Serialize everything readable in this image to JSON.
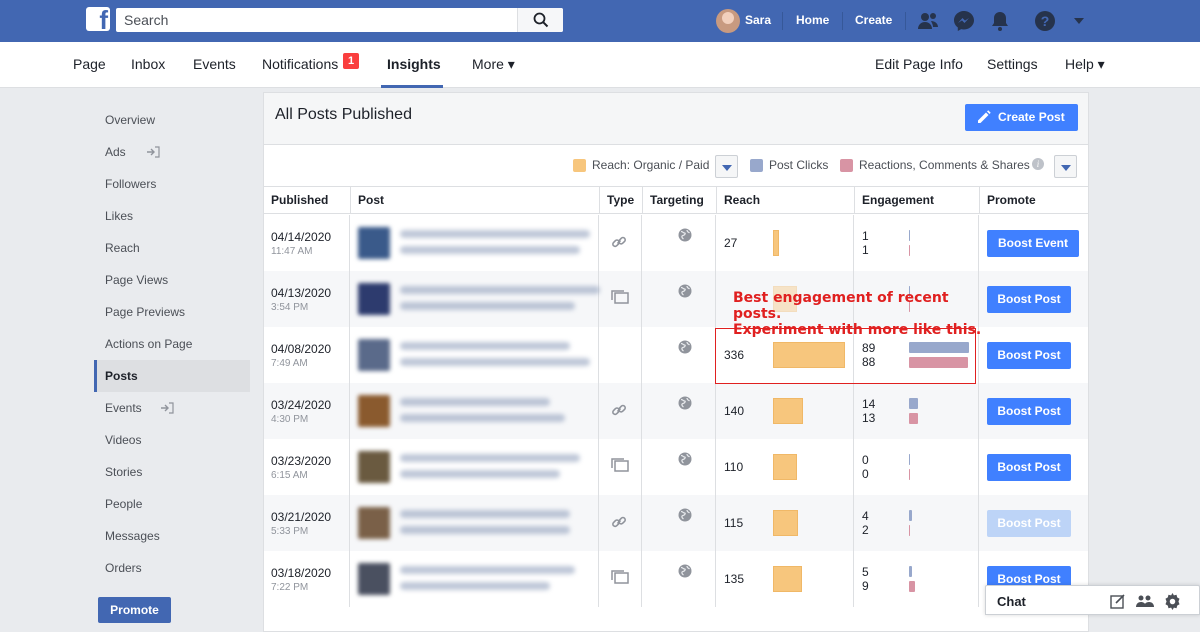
{
  "topbar": {
    "search_placeholder": "Search",
    "user_name": "Sara",
    "home": "Home",
    "create": "Create"
  },
  "tabs": [
    {
      "label": "Page"
    },
    {
      "label": "Inbox"
    },
    {
      "label": "Events"
    },
    {
      "label": "Notifications",
      "badge": "1"
    },
    {
      "label": "Insights",
      "active": true
    },
    {
      "label": "More ▾"
    },
    {
      "label": "Edit Page Info"
    },
    {
      "label": "Settings"
    },
    {
      "label": "Help ▾"
    }
  ],
  "sidebar": {
    "items": [
      {
        "label": "Overview"
      },
      {
        "label": "Ads"
      },
      {
        "label": "Followers"
      },
      {
        "label": "Likes"
      },
      {
        "label": "Reach"
      },
      {
        "label": "Page Views"
      },
      {
        "label": "Page Previews"
      },
      {
        "label": "Actions on Page"
      },
      {
        "label": "Posts",
        "active": true
      },
      {
        "label": "Events"
      },
      {
        "label": "Videos"
      },
      {
        "label": "Stories"
      },
      {
        "label": "People"
      },
      {
        "label": "Messages"
      },
      {
        "label": "Orders"
      }
    ],
    "promote": "Promote"
  },
  "panel": {
    "title": "All Posts Published",
    "create_post": "Create Post",
    "legend": {
      "reach": "Reach: Organic / Paid",
      "clicks": "Post Clicks",
      "reactions": "Reactions, Comments & Shares"
    },
    "colors": {
      "reach": "#f7c67d",
      "clicks": "#98a8cc",
      "reactions": "#d894a4",
      "boost": "#4080ff"
    },
    "headers": [
      "Published",
      "Post",
      "Type",
      "Targeting",
      "Reach",
      "Engagement",
      "Promote"
    ]
  },
  "rows": [
    {
      "date": "04/14/2020",
      "time": "11:47 AM",
      "type": "link-icon",
      "reach": "27",
      "clicks": "1",
      "reactions": "1",
      "promote": "Boost Event",
      "disabled": false
    },
    {
      "date": "04/13/2020",
      "time": "3:54 PM",
      "type": "album-icon",
      "reach": "",
      "clicks": "",
      "reactions": "",
      "promote": "Boost Post",
      "disabled": false
    },
    {
      "date": "04/08/2020",
      "time": "7:49 AM",
      "type": "",
      "reach": "336",
      "clicks": "89",
      "reactions": "88",
      "promote": "Boost Post",
      "disabled": false
    },
    {
      "date": "03/24/2020",
      "time": "4:30 PM",
      "type": "link-icon",
      "reach": "140",
      "clicks": "14",
      "reactions": "13",
      "promote": "Boost Post",
      "disabled": false
    },
    {
      "date": "03/23/2020",
      "time": "6:15 AM",
      "type": "album-icon",
      "reach": "110",
      "clicks": "0",
      "reactions": "0",
      "promote": "Boost Post",
      "disabled": false
    },
    {
      "date": "03/21/2020",
      "time": "5:33 PM",
      "type": "link-icon",
      "reach": "115",
      "clicks": "4",
      "reactions": "2",
      "promote": "Boost Post",
      "disabled": true
    },
    {
      "date": "03/18/2020",
      "time": "7:22 PM",
      "type": "album-icon",
      "reach": "135",
      "clicks": "5",
      "reactions": "9",
      "promote": "Boost Post",
      "disabled": false
    }
  ],
  "callout": {
    "line1": "Best engagement of recent posts.",
    "line2": "Experiment with more like this."
  },
  "chat": {
    "label": "Chat"
  }
}
